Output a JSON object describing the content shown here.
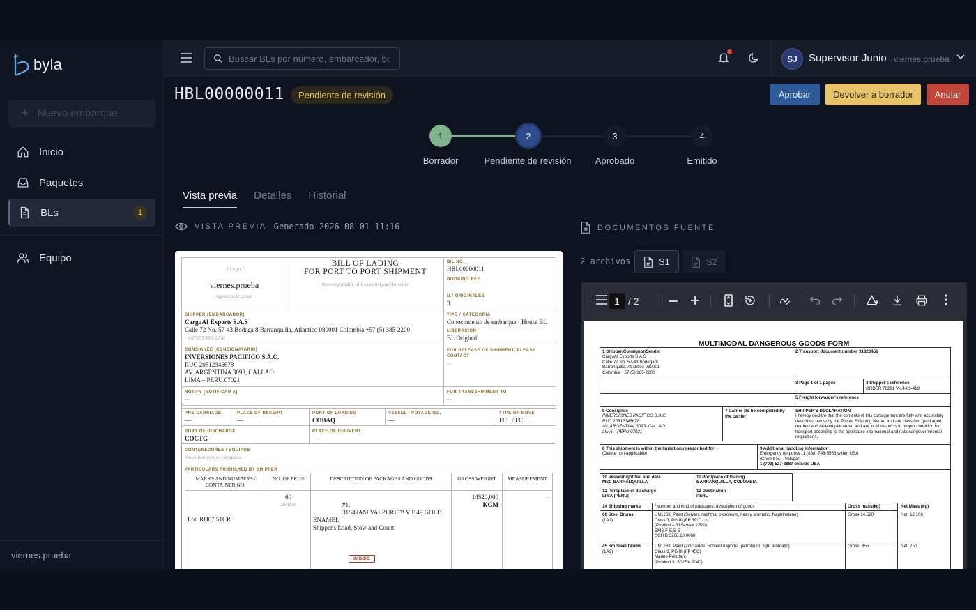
{
  "app": {
    "logo_text": "byla",
    "user_org": "viernes.prueba"
  },
  "sidebar": {
    "new_button": "Nuevo embarque",
    "items": [
      {
        "label": "Inicio",
        "icon": "home-icon"
      },
      {
        "label": "Paquetes",
        "icon": "inbox-icon"
      },
      {
        "label": "BLs",
        "icon": "file-icon",
        "badge": "1",
        "active": true
      },
      {
        "label": "Equipo",
        "icon": "users-icon"
      }
    ],
    "footer": "viernes.prueba"
  },
  "header": {
    "search_placeholder": "Buscar BLs por número, embarcador, bc",
    "user_initials": "SJ",
    "user_name": "Supervisor Junio",
    "user_org": "· viernes.prueba"
  },
  "bl": {
    "number": "HBL00000011",
    "status": "Pendiente de revisión",
    "actions": {
      "approve": "Aprobar",
      "return": "Devolver a borrador",
      "cancel": "Anular"
    },
    "steps": [
      {
        "num": "1",
        "label": "Borrador",
        "state": "done"
      },
      {
        "num": "2",
        "label": "Pendiente de revisión",
        "state": "current"
      },
      {
        "num": "3",
        "label": "Aprobado",
        "state": "todo"
      },
      {
        "num": "4",
        "label": "Emitido",
        "state": "todo"
      }
    ],
    "tabs": [
      "Vista previa",
      "Detalles",
      "Historial"
    ],
    "active_tab": "Vista previa"
  },
  "preview": {
    "section_label": "VISTA PREVIA",
    "generated": "Generado 2026-08-01 11:16",
    "doc": {
      "logo_placeholder": "[ Logo ]",
      "company": "viernes.prueba",
      "company_sub": "Agencia de carga",
      "title_1": "BILL OF LADING",
      "title_2": "FOR PORT TO PORT SHIPMENT",
      "title_note": "Non-negotiable unless consigned to order",
      "bl_no_label": "B/L NO.",
      "bl_no": "HBL00000011",
      "booking_label": "BOOKING REF.",
      "booking": "—",
      "originals_label": "N.º ORIGINALES",
      "originals": "3",
      "shipper_label": "SHIPPER (EMBARCADOR)",
      "shipper_name": "CarguAI Exports S.A.S",
      "shipper_addr": "Calle 72 No. 57-43 Bodega 8 Barranquilla, Atlantico 080001 Colombia +57 (5) 385-2200",
      "shipper_phone": "· +57 (5) 385-2200",
      "tipo_label": "TIPO / CATEGORÍA",
      "tipo": "Conocimiento de embarque · House BL",
      "liberacion_label": "LIBERACIÓN",
      "liberacion": "BL Original",
      "consignee_label": "CONSIGNEE (CONSIGNATARIO)",
      "consignee_1": "INVERSIONES PACIFICO S.A.C.",
      "consignee_2": "RUC 20512345678",
      "consignee_3": "AV. ARGENTINA 3093, CALLAO",
      "consignee_4": "LIMA – PERU 07021",
      "release_label": "FOR RELEASE OF SHIPMENT, PLEASE CONTACT",
      "release": "—",
      "notify_label": "NOTIFY (NOTIFICAR A)",
      "notify": "—",
      "transship_label": "FOR TRANSSHIPMENT TO",
      "transship": "—",
      "precarriage_label": "PRE-CARRIAGE",
      "precarriage": "—",
      "receipt_label": "PLACE OF RECEIPT",
      "receipt": "—",
      "loading_label": "PORT OF LOADING",
      "loading": "COBAQ",
      "vessel_label": "VESSEL / VOYAGE NO.",
      "vessel": "—",
      "move_label": "TYPE OF MOVE",
      "move": "FCL / FCL",
      "discharge_label": "PORT OF DISCHARGE",
      "discharge": "COCTG",
      "delivery_label": "PLACE OF DELIVERY",
      "delivery": "—",
      "containers_label": "CONTENEDORES / EQUIPOS",
      "containers": "Sin contenedores cargados.",
      "particulars_label": "PARTICULARS FURNISHED BY SHIPPER",
      "col_marks": "MARKS AND NUMBERS / CONTAINER NO.",
      "col_pkgs": "NO. OF PKGS",
      "col_desc": "DESCRIPTION OF PACKAGES AND GOODS",
      "col_gross": "GROSS WEIGHT",
      "col_meas": "MEASUREMENT",
      "row_lot": "Lot: RH07 51CR",
      "row_pkgs": "60",
      "row_pkgs_type": "Tambor",
      "row_desc_1": "#1.",
      "row_desc_2": "31S49AM VALPURE™ V3149 GOLD",
      "row_desc_3": "ENAMEL",
      "row_desc_4": "Shipper's Load, Stow and Count",
      "row_gross": "14520,000",
      "row_gross_unit": "KGM",
      "row_meas": "—",
      "imo_tag": "IMO/DG"
    }
  },
  "sources": {
    "section_label": "DOCUMENTOS FUENTE",
    "count": "2 archivos",
    "files": [
      {
        "label": "S1",
        "active": true
      },
      {
        "label": "S2",
        "active": false
      }
    ],
    "viewer": {
      "page": "1",
      "total": "/ 2",
      "page_title": "MULTIMODAL DANGEROUS GOODS FORM",
      "f1_label": "1 Shipper/Consignor/Sender",
      "f1": [
        "CarguAI Exports S.A.S",
        "Calle 72 No. 57-43 Bodega 8",
        "Barranquilla, Atlantico 080001",
        "Colombia +57 (5) 385-2200"
      ],
      "f2": "2 Transport document number 91823456",
      "f3": "3 Page 1 of 1 pages",
      "f4_label": "4 Shipper's reference",
      "f4": "ORDER 78291 V-14-03-419",
      "f5": "5 Freight forwarder's reference",
      "f6_label": "6 Consignee",
      "f6": [
        "INVERSIONES PACIFICO S.A.C.",
        "RUC 20512345678",
        "AV. ARGENTINA 3093, CALLAO",
        "LIMA – PERU 07021"
      ],
      "f7": "7 Carrier (to be completed by the carrier)",
      "decl_label": "SHIPPER'S DECLARATION",
      "decl": "I hereby declare that the contents of this consignment are fully and accurately described below by the Proper Shipping Name, and are classified, packaged, marked and labeled/placarded and are in all respects in proper condition for transport according to the applicable international and national governmental regulations.",
      "f8_label": "8 This shipment is within the limitations prescribed for:",
      "f8": "(Delete non-applicable)",
      "f9_label": "9 Additional handling information",
      "f9_1": "Emergency response: 1 (888) 748-5558 within USA",
      "f9_2": "(Chemtrec – Valspar)",
      "f9_3": "1 (703) 527-3887 outside USA",
      "f10_label": "10 Vessel/flight No. and date",
      "f10": "MSC BARRANQUILLA",
      "f11_label": "11 Port/place of loading",
      "f11": "BARRANQUILLA, COLOMBIA",
      "f12_label": "12 Port/place of discharge",
      "f12": "LIMA (PERU)",
      "f13_label": "13 Destination",
      "f13": "PERU",
      "f14_label": "14 Shipping marks",
      "f14_desc": "*Number and kind of packages; description of goods",
      "f14_gross": "Gross mass(kg)",
      "f14_net": "Net Mass (kg)",
      "r1_marks": "60 Steel Drums",
      "r1_marks2": "(1A1)",
      "r1_desc": [
        "UN1263, Paint (Solvent naphtha, petroleum, heavy aromatic, Naphthalene)",
        "Class 3, PG III (FP 39°C c.c.)",
        "(Product – 31S49AM.1520)",
        "EMS F-E,S-E",
        "SCH B 3208.10.0000"
      ],
      "r1_gross": "Gross 14,520",
      "r1_net": "Net: 12,106",
      "r2_marks": "45 Sm Steel Drums",
      "r2_marks2": "(1A2)",
      "r2_desc": [
        "UN1263, Paint (Zinc oxide, Solvent naphtha, petroleum, light aromatic)",
        "Class 3, PG III (FP 45C)",
        "Marine Pollutant",
        "(Product 31S02EA.2040)"
      ],
      "r2_gross": "Gross: 855",
      "r2_net": "Net: 750"
    }
  },
  "colors": {
    "accent": "#2d5a98",
    "warning": "#e8c368",
    "danger": "#c0463a",
    "step_done": "#7fb38a",
    "step_current": "#2f4a8a"
  }
}
